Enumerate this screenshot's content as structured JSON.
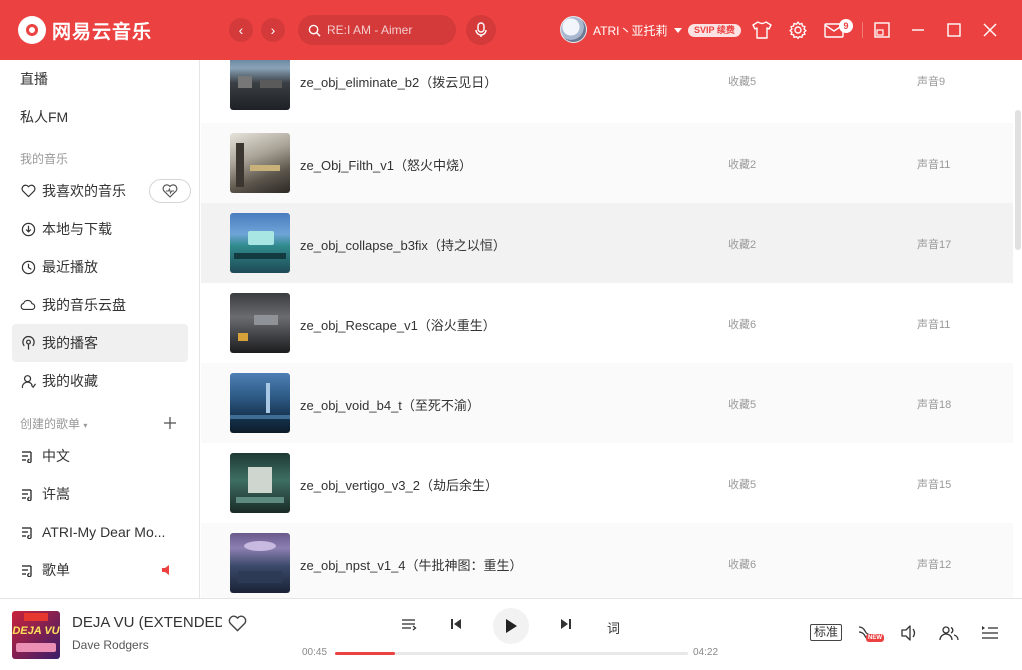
{
  "app": {
    "title": "网易云音乐"
  },
  "search": {
    "placeholder": "RE:I AM - Aimer"
  },
  "user": {
    "name": "ATRI丶亚托莉",
    "vip_badge": "SVIP 续费"
  },
  "header": {
    "message_count": "9"
  },
  "sidebar": {
    "top_items": [
      {
        "label": "直播"
      },
      {
        "label": "私人FM"
      }
    ],
    "my_music_heading": "我的音乐",
    "my_music": [
      {
        "label": "我喜欢的音乐",
        "icon": "heart-icon"
      },
      {
        "label": "本地与下载",
        "icon": "download-icon"
      },
      {
        "label": "最近播放",
        "icon": "clock-icon"
      },
      {
        "label": "我的音乐云盘",
        "icon": "cloud-icon"
      },
      {
        "label": "我的播客",
        "icon": "podcast-icon"
      },
      {
        "label": "我的收藏",
        "icon": "user-icon"
      }
    ],
    "created_heading": "创建的歌单",
    "playlists": [
      {
        "label": "中文"
      },
      {
        "label": "许嵩"
      },
      {
        "label": "ATRI-My Dear Mo..."
      },
      {
        "label": "歌单"
      }
    ]
  },
  "rows": [
    {
      "title": "ze_obj_eliminate_b2（拨云见日）",
      "fav": "收藏5",
      "vol": "声音9"
    },
    {
      "title": "ze_Obj_Filth_v1（怒火中烧）",
      "fav": "收藏2",
      "vol": "声音11"
    },
    {
      "title": "ze_obj_collapse_b3fix（持之以恒）",
      "fav": "收藏2",
      "vol": "声音17"
    },
    {
      "title": "ze_obj_Rescape_v1（浴火重生）",
      "fav": "收藏6",
      "vol": "声音11"
    },
    {
      "title": "ze_obj_void_b4_t（至死不渝）",
      "fav": "收藏5",
      "vol": "声音18"
    },
    {
      "title": "ze_obj_vertigo_v3_2（劫后余生）",
      "fav": "收藏5",
      "vol": "声音15"
    },
    {
      "title": "ze_obj_npst_v1_4（牛批神图：重生）",
      "fav": "收藏6",
      "vol": "声音12"
    }
  ],
  "player": {
    "song": "DEJA VU (EXTENDED",
    "artist": "Dave Rodgers",
    "cover_text": "DEJA VU",
    "current_time": "00:45",
    "total_time": "04:22",
    "progress": 0.17,
    "lyric_label": "词",
    "quality": "标准",
    "new_label": "NEW"
  },
  "colors": {
    "accent": "#ec4141"
  }
}
